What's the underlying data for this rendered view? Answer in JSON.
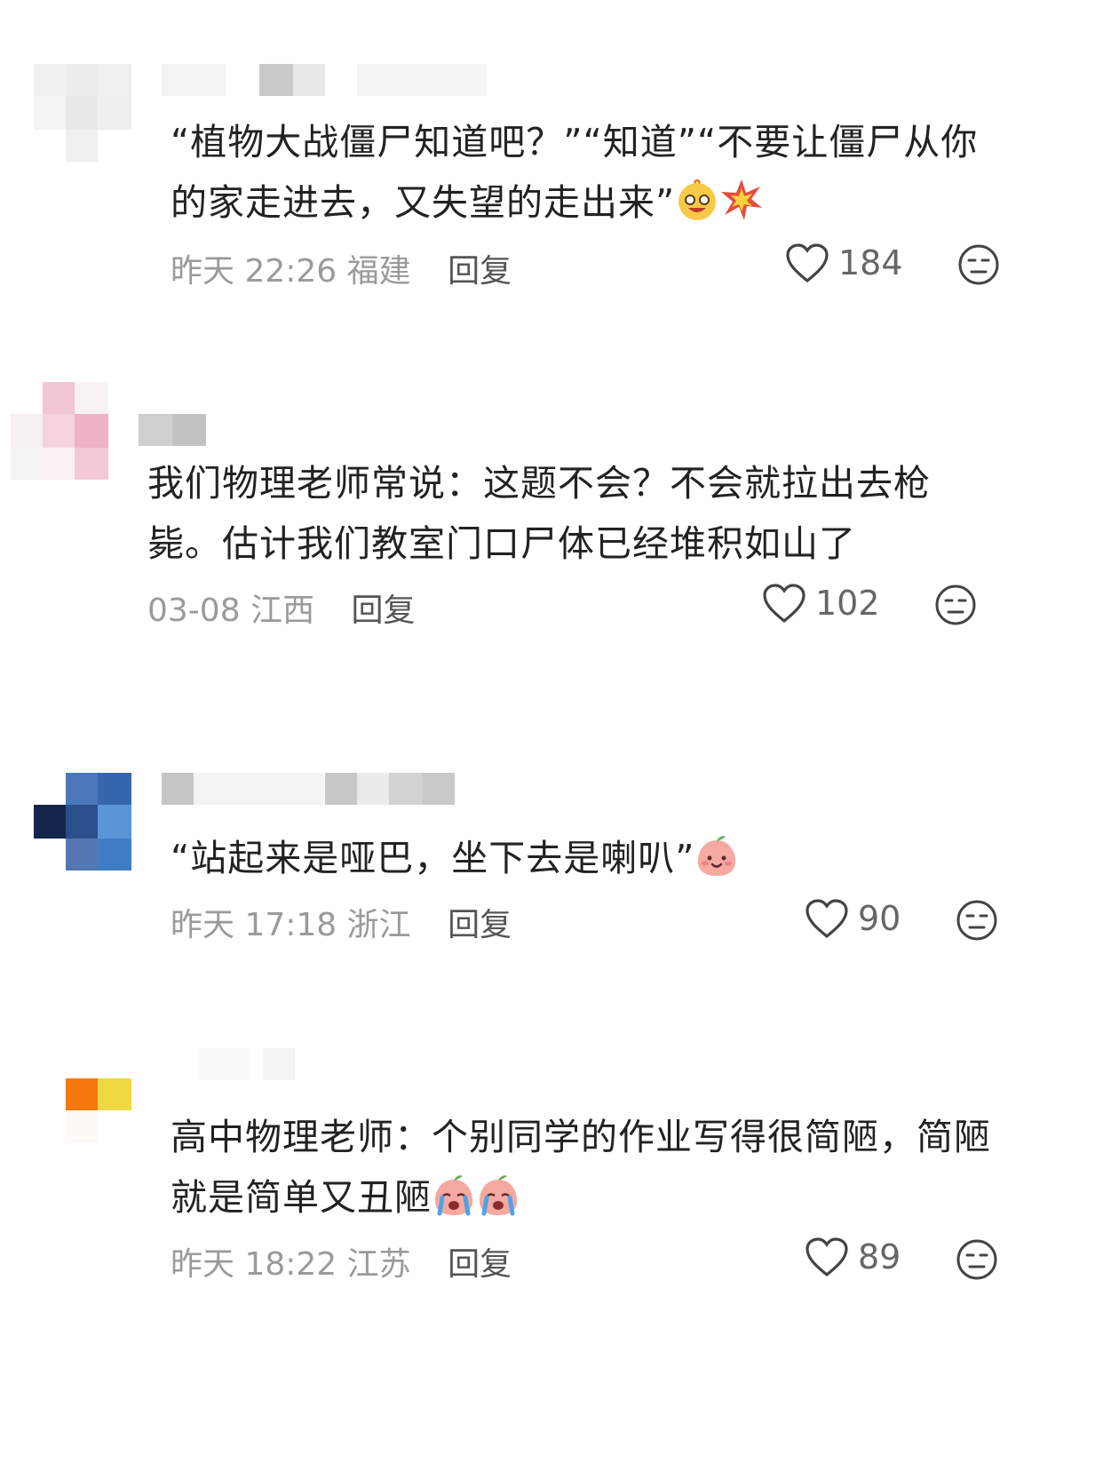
{
  "comments": [
    {
      "text_lines": [
        "“植物大战僵尸知道吧？”“知道”“不要让僵尸从你",
        "的家走进去，又失望的走出来”"
      ],
      "time": "昨天 22:26",
      "region": "福建",
      "reply": "回复",
      "likes": "184",
      "emojis": [
        "laughing-face-emoji",
        "collision-emoji"
      ]
    },
    {
      "text_lines": [
        "我们物理老师常说：这题不会？不会就拉出去枪",
        "毙。估计我们教室门口尸体已经堆积如山了"
      ],
      "time": "03-08",
      "region": "江西",
      "reply": "回复",
      "likes": "102",
      "emojis": []
    },
    {
      "text_lines": [
        "“站起来是哑巴，坐下去是喇叭”"
      ],
      "time": "昨天 17:18",
      "region": "浙江",
      "reply": "回复",
      "likes": "90",
      "emojis": [
        "smile-peach-emoji"
      ]
    },
    {
      "text_lines": [
        "高中物理老师：个别同学的作业写得很简陋，简陋",
        "就是简单又丑陋"
      ],
      "time": "昨天 18:22",
      "region": "江苏",
      "reply": "回复",
      "likes": "89",
      "emojis": [
        "crying-peach-emoji",
        "crying-peach-emoji"
      ]
    }
  ],
  "icons": {
    "like": "heart-outline-icon",
    "dislike": "neutral-face-icon"
  }
}
